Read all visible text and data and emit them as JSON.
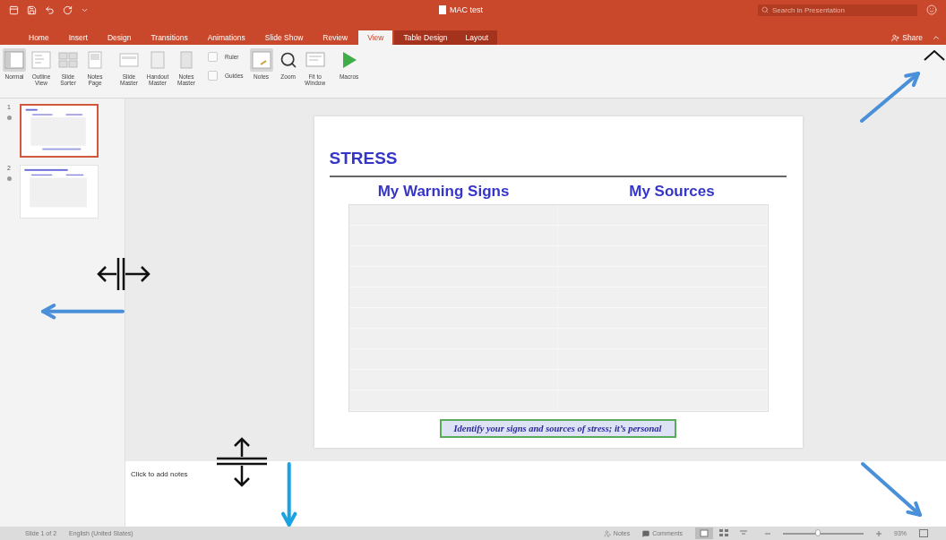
{
  "title_bar": {
    "title": "MAC test",
    "search": {
      "placeholder": "Search in Presentation"
    }
  },
  "tabs": [
    {
      "label": "Home",
      "selected": false,
      "kind": "standard"
    },
    {
      "label": "Insert",
      "selected": false,
      "kind": "standard"
    },
    {
      "label": "Design",
      "selected": false,
      "kind": "standard"
    },
    {
      "label": "Transitions",
      "selected": false,
      "kind": "standard"
    },
    {
      "label": "Animations",
      "selected": false,
      "kind": "standard"
    },
    {
      "label": "Slide Show",
      "selected": false,
      "kind": "standard"
    },
    {
      "label": "Review",
      "selected": false,
      "kind": "standard"
    },
    {
      "label": "View",
      "selected": true,
      "kind": "standard"
    },
    {
      "label": "Table Design",
      "selected": false,
      "kind": "contextual"
    },
    {
      "label": "Layout",
      "selected": false,
      "kind": "contextual"
    }
  ],
  "share": {
    "label": "Share"
  },
  "ribbon": [
    {
      "items": [
        {
          "kind": "normal",
          "label": "Normal",
          "selected": true
        },
        {
          "kind": "outline",
          "label": "Outline View",
          "selected": false
        },
        {
          "kind": "sorter",
          "label": "Slide Sorter",
          "selected": false
        },
        {
          "kind": "notes-page",
          "label": "Notes Page",
          "selected": false
        }
      ]
    },
    {
      "items": [
        {
          "kind": "slide-master",
          "label": "Slide Master",
          "selected": false
        },
        {
          "kind": "handout-master",
          "label": "Handout Master",
          "selected": false
        },
        {
          "kind": "notes-master",
          "label": "Notes Master",
          "selected": false
        }
      ]
    },
    {
      "checks": [
        {
          "label": "Ruler",
          "checked": false
        },
        {
          "label": "Guides",
          "checked": false
        }
      ],
      "items": [
        {
          "kind": "notes",
          "label": "Notes",
          "selected": true
        },
        {
          "kind": "zoom",
          "label": "Zoom",
          "selected": false
        },
        {
          "kind": "fit",
          "label": "Fit to Window",
          "selected": false
        }
      ]
    },
    {
      "items": [
        {
          "kind": "macros",
          "label": "Macros",
          "selected": false
        }
      ]
    }
  ],
  "slides": [
    {
      "number": "1",
      "selected": true,
      "kind": "title-table"
    },
    {
      "number": "2",
      "selected": false,
      "kind": "long-title-table"
    }
  ],
  "slide": {
    "title": "STRESS",
    "columns": [
      "My Warning Signs",
      "My Sources"
    ],
    "caption": "Identify your signs and sources of stress; it’s personal"
  },
  "notes": {
    "placeholder": "Click to add notes"
  },
  "status_bar": {
    "slide": "Slide 1 of 2",
    "language": "English (United States)",
    "notes": "Notes",
    "comments": "Comments",
    "views": [
      {
        "kind": "normal",
        "selected": true
      },
      {
        "kind": "sorter",
        "selected": false
      },
      {
        "kind": "reading",
        "selected": false
      }
    ],
    "zoom": {
      "level": 0.45
    },
    "zoom_percent": "93%"
  }
}
